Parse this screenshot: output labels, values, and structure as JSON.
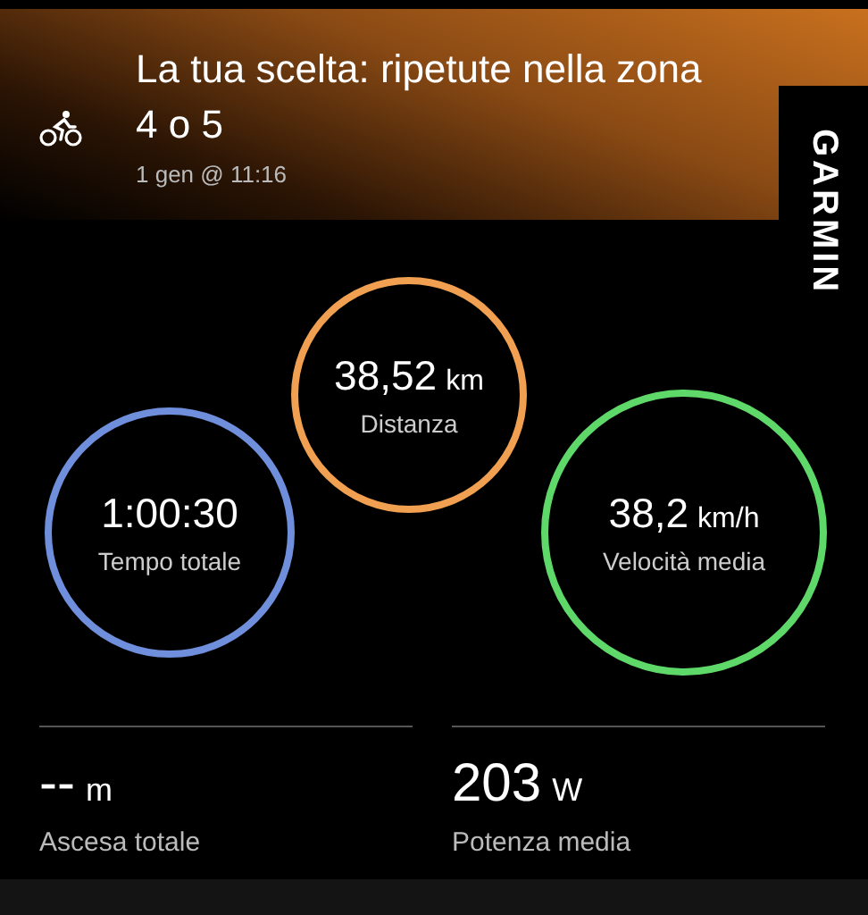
{
  "header": {
    "title": "La tua scelta: ripetute nella zona 4 o 5",
    "date": "1 gen @ 11:16"
  },
  "brand": "GARMIN",
  "rings": [
    {
      "value": "1:00:30",
      "label": "Tempo totale",
      "color": "#6f8fdc"
    },
    {
      "value": "38,52",
      "unit": "km",
      "label": "Distanza",
      "color": "#f0a050"
    },
    {
      "value": "38,2",
      "unit": "km/h",
      "label": "Velocità media",
      "color": "#5fd86a"
    }
  ],
  "stats": [
    {
      "value": "--",
      "unit": "m",
      "label": "Ascesa totale"
    },
    {
      "value": "203",
      "unit": "W",
      "label": "Potenza media"
    }
  ]
}
